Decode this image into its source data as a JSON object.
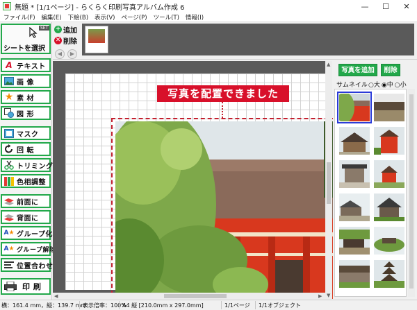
{
  "window": {
    "title": "無題 * [1/1ページ] - らくらく印刷写真アルバム作成 6",
    "minimize": "—",
    "maximize": "☐",
    "close": "✕"
  },
  "menu": [
    "ファイル(F)",
    "編集(E)",
    "下絵(B)",
    "表示(V)",
    "ページ(P)",
    "ツール(T)",
    "情報(I)"
  ],
  "sidebar": {
    "select_sheet": {
      "label": "シートを選択",
      "badge": "SET"
    },
    "tools": [
      {
        "label": "テキスト",
        "icon": "text-a-icon"
      },
      {
        "label": "画 像",
        "icon": "image-icon"
      },
      {
        "label": "素 材",
        "icon": "star-icon"
      },
      {
        "label": "図 形",
        "icon": "shape-icon"
      },
      {
        "label": "マスク",
        "icon": "mask-icon"
      },
      {
        "label": "回 転",
        "icon": "rotate-icon"
      },
      {
        "label": "トリミング",
        "icon": "scissors-icon"
      },
      {
        "label": "色相調整",
        "icon": "color-bars-icon"
      },
      {
        "label": "前面に",
        "icon": "bring-front-icon"
      },
      {
        "label": "背面に",
        "icon": "send-back-icon"
      },
      {
        "label": "グループ化",
        "icon": "group-icon"
      },
      {
        "label": "グループ解除",
        "icon": "ungroup-icon"
      },
      {
        "label": "位置合わせ",
        "icon": "align-icon"
      },
      {
        "label": "印 刷",
        "icon": "printer-icon"
      }
    ]
  },
  "pages": {
    "add_label": "追加",
    "delete_label": "削除",
    "prev": "◀",
    "next": "▶"
  },
  "canvas": {
    "message": "写真を配置できました"
  },
  "photos_panel": {
    "add_button": "写真を追加",
    "delete_button": "削除",
    "thumbnail_label": "サムネイル",
    "size_options": [
      "大",
      "中",
      "小"
    ],
    "size_selected": "中"
  },
  "status": {
    "size": "横：161.4 mm，縦：139.7 mm",
    "zoom": "表示倍率：100%",
    "paper": "A4 縦 [210.0mm x 297.0mm]",
    "page": "1/1ページ",
    "objects": "1/1オブジェクト"
  },
  "colors": {
    "accent_green": "#22a84a",
    "alert_red": "#d8102a",
    "selection_blue": "#2a3bd8"
  }
}
